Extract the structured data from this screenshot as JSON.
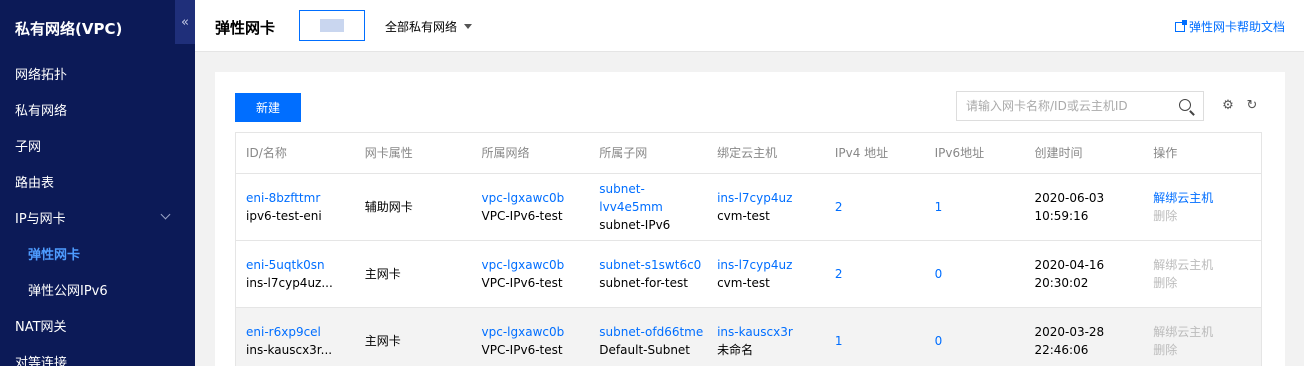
{
  "sidebar": {
    "title": "私有网络(VPC)",
    "collapse_icon": "«",
    "items": [
      {
        "label": "网络拓扑"
      },
      {
        "label": "私有网络"
      },
      {
        "label": "子网"
      },
      {
        "label": "路由表"
      },
      {
        "label": "IP与网卡"
      },
      {
        "label": "弹性网卡"
      },
      {
        "label": "弹性公网IPv6"
      },
      {
        "label": "NAT网关"
      },
      {
        "label": "对等连接"
      }
    ]
  },
  "topbar": {
    "title": "弹性网卡",
    "vpc_filter": "全部私有网络",
    "help_link": "弹性网卡帮助文档"
  },
  "toolbar": {
    "new_button": "新建",
    "search_placeholder": "请输入网卡名称/ID或云主机ID",
    "settings_icon": "⚙",
    "refresh_icon": "↻"
  },
  "table": {
    "columns": [
      "ID/名称",
      "网卡属性",
      "所属网络",
      "所属子网",
      "绑定云主机",
      "IPv4 地址",
      "IPv6地址",
      "创建时间",
      "操作"
    ],
    "rows": [
      {
        "id": "eni-8bzfttmr",
        "name": "ipv6-test-eni",
        "attr": "辅助网卡",
        "vpc_id": "vpc-lgxawc0b",
        "vpc_name": "VPC-IPv6-test",
        "subnet_id": "subnet-lvv4e5mm",
        "subnet_name": "subnet-IPv6",
        "cvm_id": "ins-l7cyp4uz",
        "cvm_name": "cvm-test",
        "ipv4": "2",
        "ipv6": "1",
        "date": "2020-06-03",
        "time": "10:59:16",
        "op1": "解绑云主机",
        "op2": "删除"
      },
      {
        "id": "eni-5uqtk0sn",
        "name": "ins-l7cyp4uz...",
        "attr": "主网卡",
        "vpc_id": "vpc-lgxawc0b",
        "vpc_name": "VPC-IPv6-test",
        "subnet_id": "subnet-s1swt6c0",
        "subnet_name": "subnet-for-test",
        "cvm_id": "ins-l7cyp4uz",
        "cvm_name": "cvm-test",
        "ipv4": "2",
        "ipv6": "0",
        "date": "2020-04-16",
        "time": "20:30:02",
        "op1": "解绑云主机",
        "op2": "删除"
      },
      {
        "id": "eni-r6xp9cel",
        "name": "ins-kauscx3r...",
        "attr": "主网卡",
        "vpc_id": "vpc-lgxawc0b",
        "vpc_name": "VPC-IPv6-test",
        "subnet_id": "subnet-ofd66tme",
        "subnet_name": "Default-Subnet",
        "cvm_id": "ins-kauscx3r",
        "cvm_name": "未命名",
        "ipv4": "1",
        "ipv6": "0",
        "date": "2020-03-28",
        "time": "22:46:06",
        "op1": "解绑云主机",
        "op2": "删除"
      }
    ]
  },
  "colors": {
    "sidebar_bg": "#0c1a57",
    "accent": "#006eff",
    "active_nav": "#4e9cff"
  }
}
